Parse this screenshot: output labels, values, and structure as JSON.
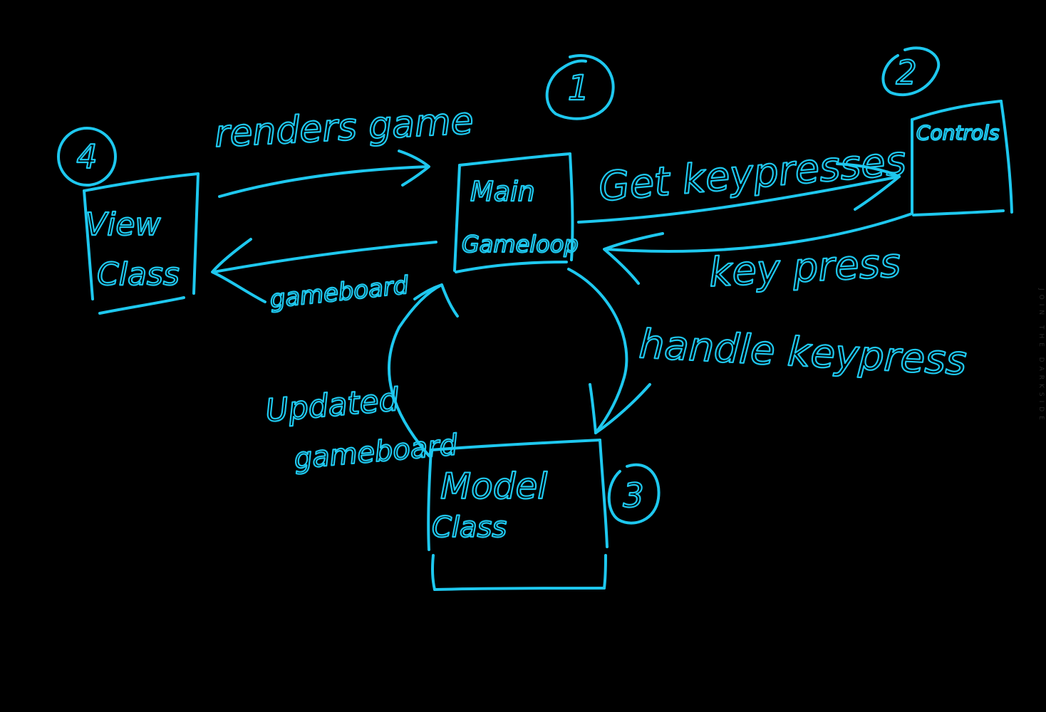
{
  "colors": {
    "ink": "#1ec8ef",
    "background": "#000000",
    "watermark": "#2a2a2a"
  },
  "nodes": {
    "main": {
      "number": "1",
      "line1": "Main",
      "line2": "Gameloop"
    },
    "controls": {
      "number": "2",
      "label": "Controls"
    },
    "model": {
      "number": "3",
      "line1": "Model",
      "line2": "Class"
    },
    "view": {
      "number": "4",
      "line1": "View",
      "line2": "Class"
    }
  },
  "edges": {
    "renders_game": "renders game",
    "get_keypresses": "Get keypresses",
    "key_press": "key press",
    "handle_keypress": "handle keypress",
    "gameboard": "gameboard",
    "updated_line1": "Updated",
    "updated_line2": "gameboard"
  },
  "watermark": "JOIN THE DARKSIDE"
}
